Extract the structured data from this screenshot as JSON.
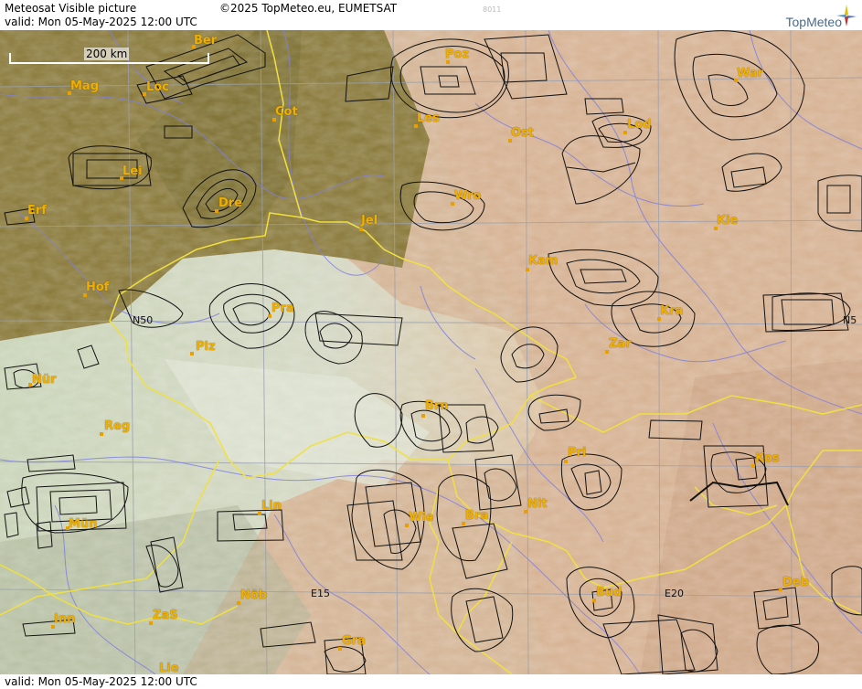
{
  "header": {
    "title": "Meteosat Visible picture",
    "copyright": "©2025 TopMeteo.eu, EUMETSAT",
    "valid": "valid:  Mon  05-May-2025  12:00 UTC",
    "code": "8011",
    "brand": "TopMeteo"
  },
  "footer": {
    "valid": "valid:  Mon  05-May-2025  12:00 UTC"
  },
  "scale": {
    "label": "200 km"
  },
  "cities": [
    {
      "name": "Ber"
    },
    {
      "name": "Poz"
    },
    {
      "name": "War"
    },
    {
      "name": "Mag"
    },
    {
      "name": "Loc"
    },
    {
      "name": "Cot"
    },
    {
      "name": "Les"
    },
    {
      "name": "Ost"
    },
    {
      "name": "Lod"
    },
    {
      "name": "Lei"
    },
    {
      "name": "Erf"
    },
    {
      "name": "Dre"
    },
    {
      "name": "Wro"
    },
    {
      "name": "Jel"
    },
    {
      "name": "Kie"
    },
    {
      "name": "Kam"
    },
    {
      "name": "Hof"
    },
    {
      "name": "Pra"
    },
    {
      "name": "Kra"
    },
    {
      "name": "Plz"
    },
    {
      "name": "Zar"
    },
    {
      "name": "Nür"
    },
    {
      "name": "Brn"
    },
    {
      "name": "Reg"
    },
    {
      "name": "Pri"
    },
    {
      "name": "Kos"
    },
    {
      "name": "Lin"
    },
    {
      "name": "Nit"
    },
    {
      "name": "Mün"
    },
    {
      "name": "Wie"
    },
    {
      "name": "Bra"
    },
    {
      "name": "Nöb"
    },
    {
      "name": "Bud"
    },
    {
      "name": "Deb"
    },
    {
      "name": "Inn"
    },
    {
      "name": "ZaS"
    },
    {
      "name": "Gra"
    },
    {
      "name": "Lie"
    }
  ],
  "grid_labels": [
    "N50",
    "N5",
    "E15",
    "E20"
  ],
  "colors": {
    "border": "#f0e040",
    "river": "#8080e0",
    "grid": "#9aa0b0",
    "label": "#f0b000"
  },
  "icons": [
    "topmeteo-logo-icon"
  ]
}
